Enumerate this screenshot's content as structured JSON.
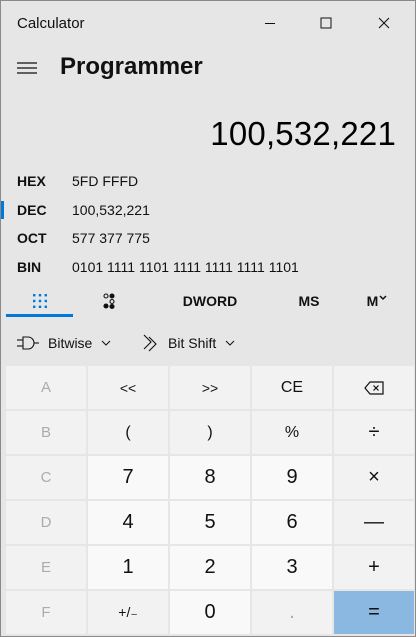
{
  "window": {
    "title": "Calculator"
  },
  "header": {
    "mode": "Programmer"
  },
  "display": {
    "value": "100,532,221"
  },
  "radix": [
    {
      "label": "HEX",
      "value": "5FD FFFD"
    },
    {
      "label": "DEC",
      "value": "100,532,221",
      "selected": true
    },
    {
      "label": "OCT",
      "value": "577 377 775"
    },
    {
      "label": "BIN",
      "value": "0101 1111 1101 1111 1111 1111 1101"
    }
  ],
  "tabs": {
    "word_size": "DWORD",
    "memory_store": "MS",
    "memory_menu": "M"
  },
  "toolbar": {
    "bitwise": "Bitwise",
    "bitshift": "Bit Shift"
  },
  "keys": {
    "A": "A",
    "lsh": "<<",
    "rsh": ">>",
    "clear": "CE",
    "backspace_icon": "backspace-icon",
    "B": "B",
    "lparen": "(",
    "rparen": ")",
    "mod": "%",
    "divide": "÷",
    "C": "C",
    "n7": "7",
    "n8": "8",
    "n9": "9",
    "multiply": "×",
    "D": "D",
    "n4": "4",
    "n5": "5",
    "n6": "6",
    "minus": "—",
    "E": "E",
    "n1": "1",
    "n2": "2",
    "n3": "3",
    "plus": "+",
    "F": "F",
    "negate": "+/₋",
    "n0": "0",
    "decimal": ".",
    "equals": "="
  },
  "colors": {
    "accent": "#0078d7",
    "equals_bg": "#8ab8e0",
    "background": "#e6e6e6"
  }
}
